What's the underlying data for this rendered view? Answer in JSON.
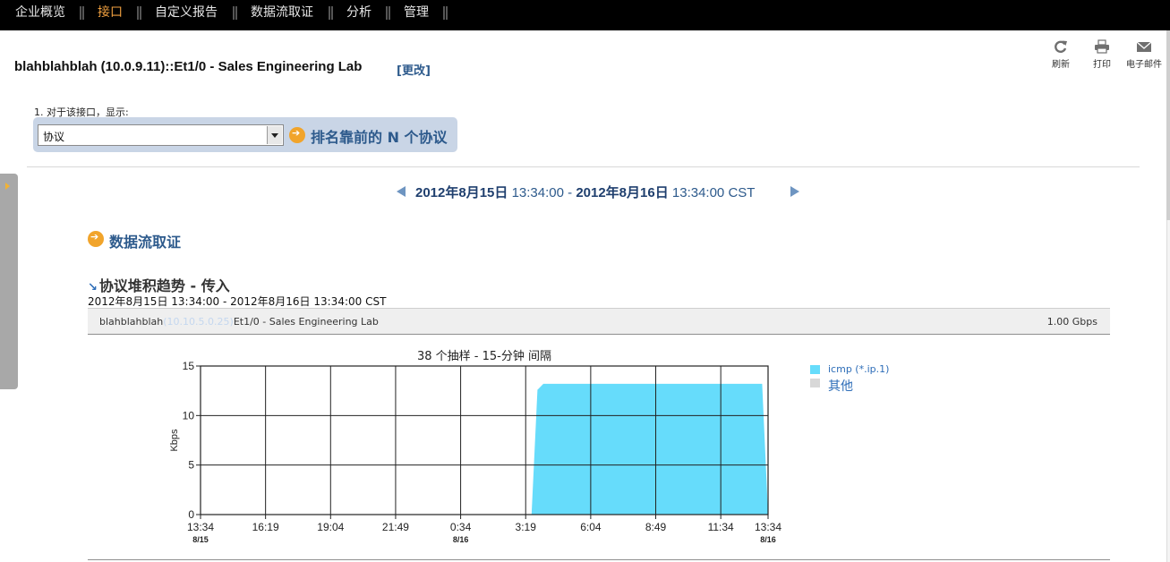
{
  "nav": {
    "items": [
      "企业概览",
      "接口",
      "自定义报告",
      "数据流取证",
      "分析",
      "管理"
    ],
    "active": "接口"
  },
  "header": {
    "title": "blahblahblah (10.0.9.11)::Et1/0 - Sales Engineering Lab",
    "change_label": "[更改]",
    "tools": {
      "refresh": "刷新",
      "print": "打印",
      "email": "电子邮件"
    }
  },
  "selector": {
    "step_label": "1. 对于该接口，显示:",
    "value": "协议",
    "action_label": "排名靠前的 N 个协议"
  },
  "date_range": {
    "start_date": "2012年8月15日",
    "start_time": "13:34:00",
    "separator": "-",
    "end_date": "2012年8月16日",
    "end_time": "13:34:00 CST"
  },
  "section": {
    "title": "数据流取证"
  },
  "report": {
    "title": "协议堆积趋势 - 传入",
    "subtitle": "2012年8月15日 13:34:00 - 2012年8月16日 13:34:00 CST",
    "interface_prefix": "blahblahblah",
    "interface_hidden": "(10.10.5.0.25)",
    "interface_suffix": "Et1/0 - Sales Engineering Lab",
    "speed": "1.00 Gbps"
  },
  "chart_data": {
    "type": "area",
    "title": "38 个抽样 - 15-分钟 间隔",
    "ylabel": "Kbps",
    "xlabel": "",
    "ylim": [
      0,
      15
    ],
    "yticks": [
      0,
      5,
      10,
      15
    ],
    "xticks": [
      {
        "time": "13:34",
        "date": "8/15"
      },
      {
        "time": "16:19",
        "date": ""
      },
      {
        "time": "19:04",
        "date": ""
      },
      {
        "time": "21:49",
        "date": ""
      },
      {
        "time": "0:34",
        "date": "8/16"
      },
      {
        "time": "3:19",
        "date": ""
      },
      {
        "time": "6:04",
        "date": ""
      },
      {
        "time": "8:49",
        "date": ""
      },
      {
        "time": "11:34",
        "date": ""
      },
      {
        "time": "13:34",
        "date": "8/16"
      }
    ],
    "grid": true,
    "legend_position": "right",
    "series": [
      {
        "name": "icmp (*.ip.1)",
        "color": "#66dcfb",
        "points": [
          [
            "3:34",
            0
          ],
          [
            "3:49",
            12.6
          ],
          [
            "4:04",
            13.2
          ],
          [
            "13:19",
            13.2
          ],
          [
            "13:34",
            0
          ]
        ]
      },
      {
        "name": "其他",
        "color": "#d8d8d8",
        "points": []
      }
    ]
  }
}
